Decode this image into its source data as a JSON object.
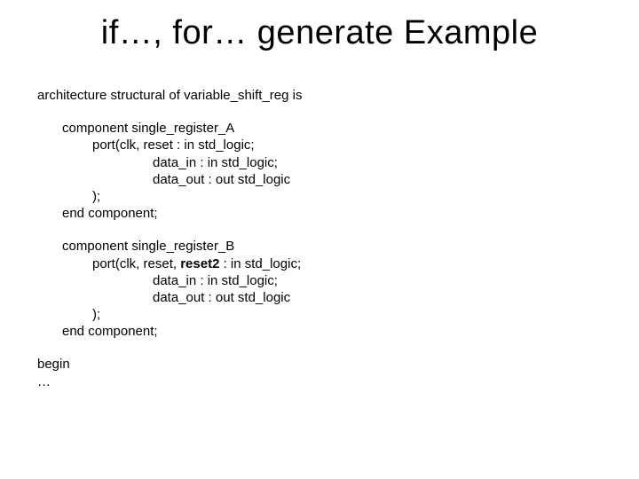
{
  "title": "if…, for… generate Example",
  "arch_line": "architecture structural of variable_shift_reg is",
  "compA": {
    "decl": "component single_register_A",
    "port_open": "port(clk, reset : in std_logic;",
    "data_in": "data_in : in std_logic;",
    "data_out": "data_out : out std_logic",
    "close": ");",
    "end": "end component;"
  },
  "compB": {
    "decl": "component single_register_B",
    "port_prefix": "port(clk, reset, ",
    "port_bold": "reset2",
    "port_suffix": " : in std_logic;",
    "data_in": "data_in : in std_logic;",
    "data_out": "data_out : out std_logic",
    "close": ");",
    "end": "end component;"
  },
  "begin": "begin",
  "ellipsis": "…"
}
